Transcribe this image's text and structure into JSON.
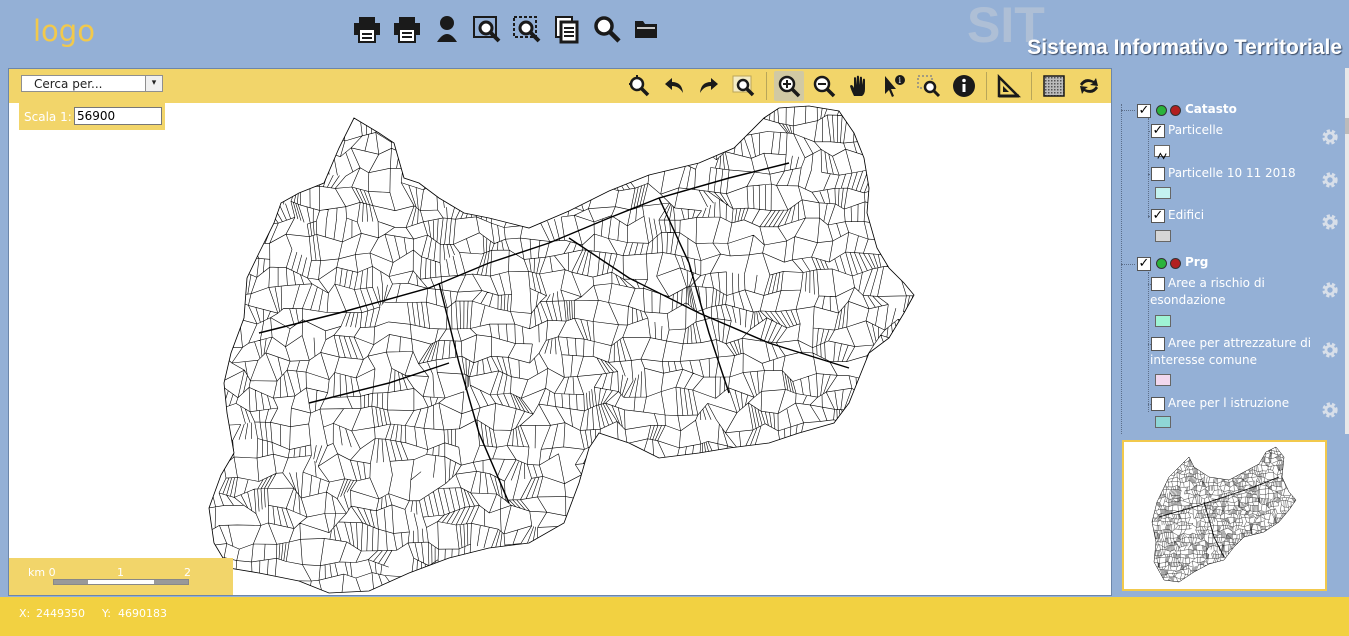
{
  "header": {
    "logo": "logo",
    "watermark": "SIT",
    "title": "Sistema Informativo Territoriale",
    "tools": [
      {
        "icon": "print-icon"
      },
      {
        "icon": "print-preview-icon"
      },
      {
        "icon": "user-icon"
      },
      {
        "icon": "zoom-window-icon"
      },
      {
        "icon": "zoom-selection-icon"
      },
      {
        "icon": "copy-document-icon"
      },
      {
        "icon": "search-icon"
      },
      {
        "icon": "folder-icon"
      }
    ]
  },
  "map": {
    "search_placeholder": "Cerca per...",
    "scale_label": "Scala 1:",
    "scale_value": "56900",
    "tools": [
      {
        "icon": "zoom-extent-icon"
      },
      {
        "icon": "undo-arrow-icon"
      },
      {
        "icon": "redo-arrow-icon"
      },
      {
        "icon": "zoom-box-icon"
      },
      {
        "icon": "zoom-in-icon"
      },
      {
        "icon": "zoom-out-icon"
      },
      {
        "icon": "pan-hand-icon"
      },
      {
        "icon": "info-select-icon"
      },
      {
        "icon": "select-zoom-icon"
      },
      {
        "icon": "info-icon"
      },
      {
        "icon": "measure-icon"
      },
      {
        "icon": "layer-grid-icon"
      },
      {
        "icon": "refresh-arrows-icon"
      }
    ],
    "active_tool": "zoom-in-icon",
    "scalebar": {
      "km_label": "km 0",
      "tick_1": "1",
      "tick_2": "2"
    }
  },
  "layers": {
    "groups": [
      {
        "name": "Catasto",
        "checked": true,
        "dot_colors": [
          "#2bb33b",
          "#b21f1f"
        ],
        "items": [
          {
            "label": "Particelle",
            "checked": true,
            "swatch": "#ffffff",
            "swatch_icon": "line-symbol-icon"
          },
          {
            "label": "Particelle 10 11 2018",
            "checked": false,
            "swatch": "#c4f2f0"
          },
          {
            "label": "Edifici",
            "checked": true,
            "swatch": "#d6d6d6"
          }
        ]
      },
      {
        "name": "Prg",
        "checked": true,
        "dot_colors": [
          "#2bb33b",
          "#b21f1f"
        ],
        "items": [
          {
            "label": "Aree a rischio di esondazione",
            "checked": false,
            "swatch": "#9ff4d4"
          },
          {
            "label": "Aree per attrezzature di interesse comune",
            "checked": false,
            "swatch": "#f2d8ee"
          },
          {
            "label": "Aree per l istruzione",
            "checked": false,
            "swatch": "#8fd6d6"
          }
        ]
      }
    ]
  },
  "footer": {
    "x_label": "X:",
    "x_value": "2449350",
    "y_label": "Y:",
    "y_value": "4690183"
  }
}
